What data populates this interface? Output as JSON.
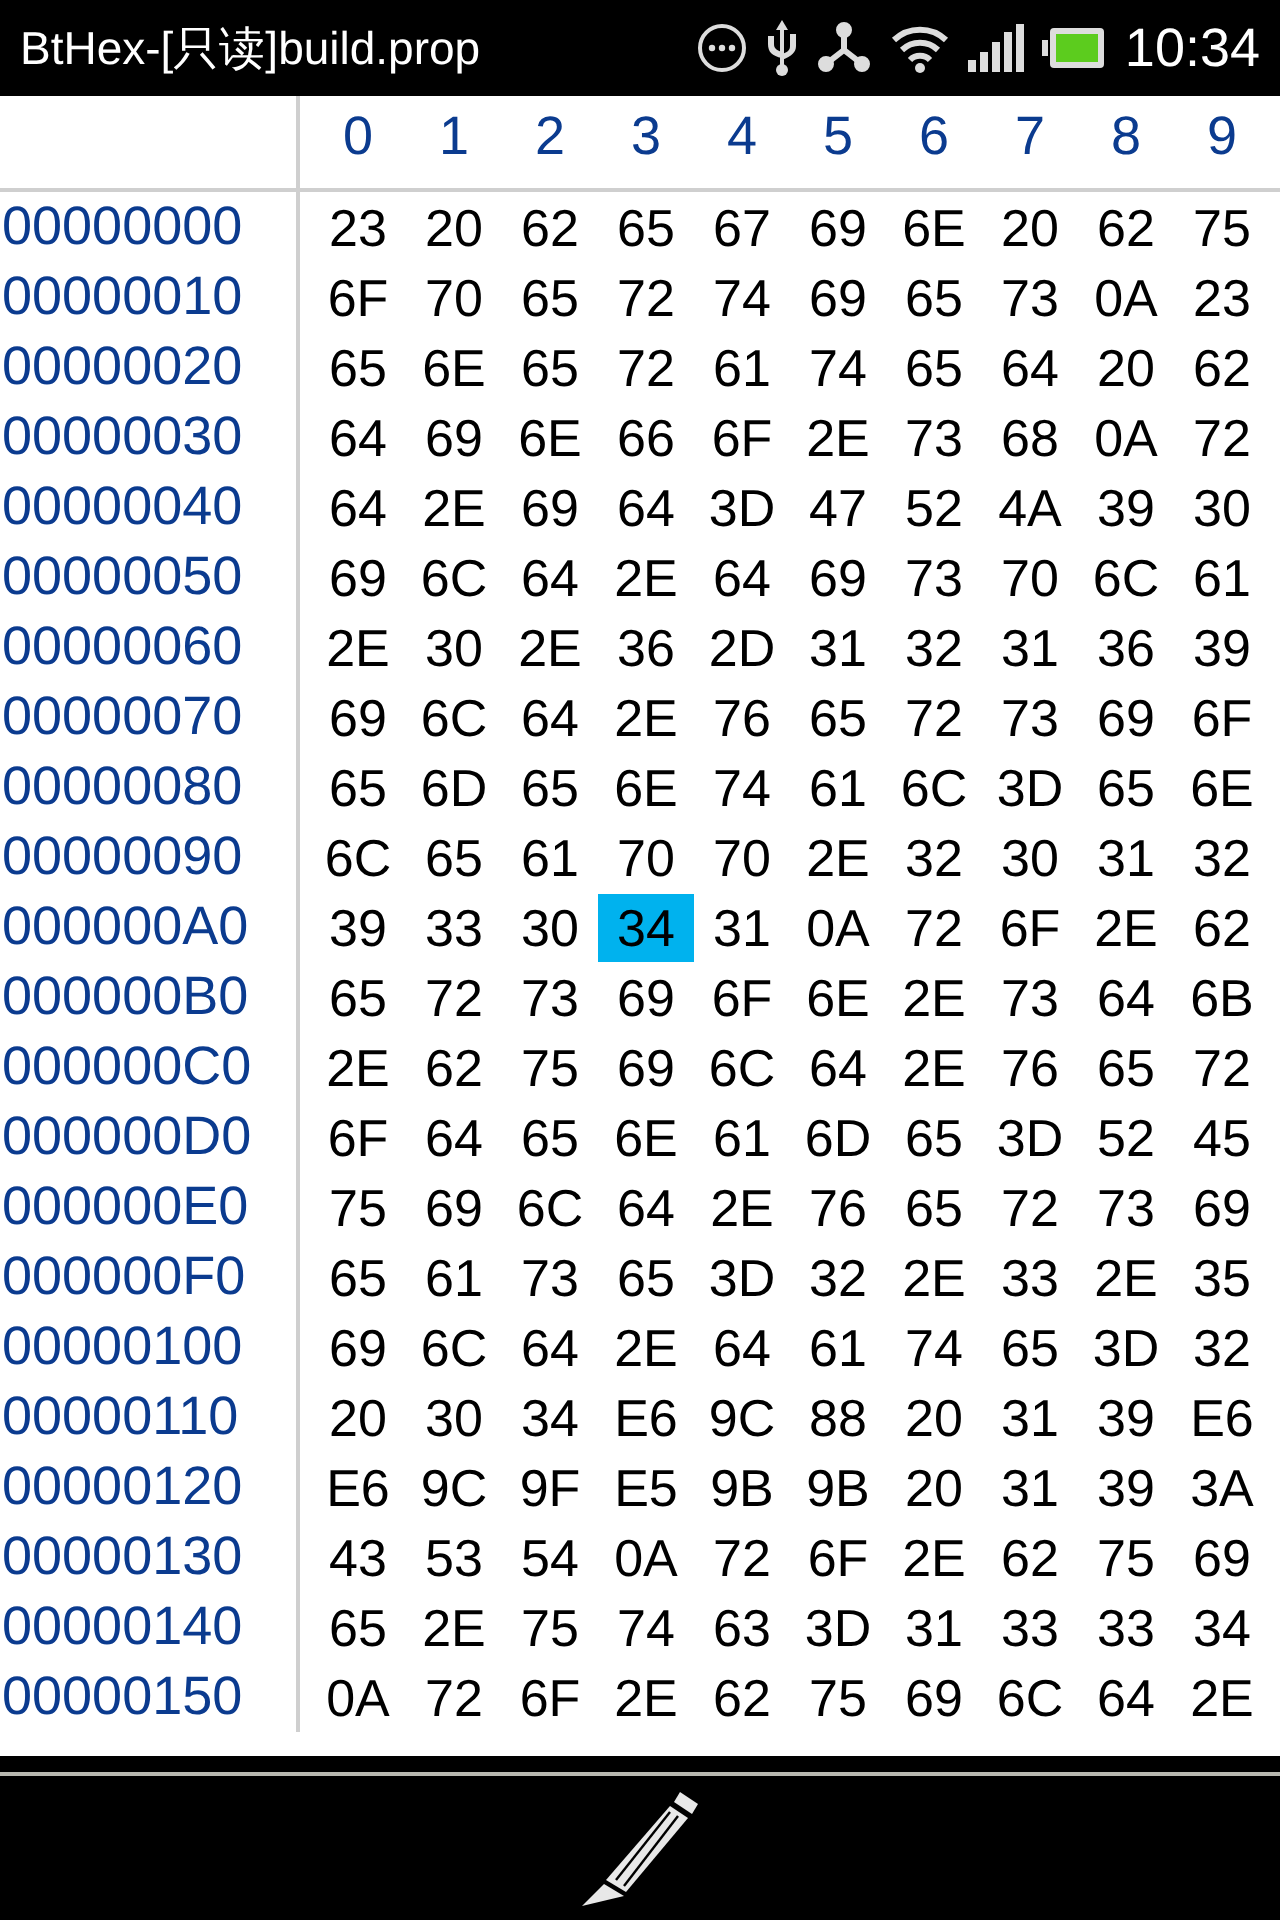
{
  "status_bar": {
    "title": "BtHex-[只读]build.prop",
    "time": "10:34"
  },
  "columns": [
    "0",
    "1",
    "2",
    "3",
    "4",
    "5",
    "6",
    "7",
    "8",
    "9"
  ],
  "rows": [
    {
      "address": "00000000",
      "cells": [
        {
          "text": "23",
          "selected": false
        },
        {
          "text": "20",
          "selected": false
        },
        {
          "text": "62",
          "selected": false
        },
        {
          "text": "65",
          "selected": false
        },
        {
          "text": "67",
          "selected": false
        },
        {
          "text": "69",
          "selected": false
        },
        {
          "text": "6E",
          "selected": false
        },
        {
          "text": "20",
          "selected": false
        },
        {
          "text": "62",
          "selected": false
        },
        {
          "text": "75",
          "selected": false
        }
      ]
    },
    {
      "address": "00000010",
      "cells": [
        {
          "text": "6F",
          "selected": false
        },
        {
          "text": "70",
          "selected": false
        },
        {
          "text": "65",
          "selected": false
        },
        {
          "text": "72",
          "selected": false
        },
        {
          "text": "74",
          "selected": false
        },
        {
          "text": "69",
          "selected": false
        },
        {
          "text": "65",
          "selected": false
        },
        {
          "text": "73",
          "selected": false
        },
        {
          "text": "0A",
          "selected": false
        },
        {
          "text": "23",
          "selected": false
        }
      ]
    },
    {
      "address": "00000020",
      "cells": [
        {
          "text": "65",
          "selected": false
        },
        {
          "text": "6E",
          "selected": false
        },
        {
          "text": "65",
          "selected": false
        },
        {
          "text": "72",
          "selected": false
        },
        {
          "text": "61",
          "selected": false
        },
        {
          "text": "74",
          "selected": false
        },
        {
          "text": "65",
          "selected": false
        },
        {
          "text": "64",
          "selected": false
        },
        {
          "text": "20",
          "selected": false
        },
        {
          "text": "62",
          "selected": false
        }
      ]
    },
    {
      "address": "00000030",
      "cells": [
        {
          "text": "64",
          "selected": false
        },
        {
          "text": "69",
          "selected": false
        },
        {
          "text": "6E",
          "selected": false
        },
        {
          "text": "66",
          "selected": false
        },
        {
          "text": "6F",
          "selected": false
        },
        {
          "text": "2E",
          "selected": false
        },
        {
          "text": "73",
          "selected": false
        },
        {
          "text": "68",
          "selected": false
        },
        {
          "text": "0A",
          "selected": false
        },
        {
          "text": "72",
          "selected": false
        }
      ]
    },
    {
      "address": "00000040",
      "cells": [
        {
          "text": "64",
          "selected": false
        },
        {
          "text": "2E",
          "selected": false
        },
        {
          "text": "69",
          "selected": false
        },
        {
          "text": "64",
          "selected": false
        },
        {
          "text": "3D",
          "selected": false
        },
        {
          "text": "47",
          "selected": false
        },
        {
          "text": "52",
          "selected": false
        },
        {
          "text": "4A",
          "selected": false
        },
        {
          "text": "39",
          "selected": false
        },
        {
          "text": "30",
          "selected": false
        }
      ]
    },
    {
      "address": "00000050",
      "cells": [
        {
          "text": "69",
          "selected": false
        },
        {
          "text": "6C",
          "selected": false
        },
        {
          "text": "64",
          "selected": false
        },
        {
          "text": "2E",
          "selected": false
        },
        {
          "text": "64",
          "selected": false
        },
        {
          "text": "69",
          "selected": false
        },
        {
          "text": "73",
          "selected": false
        },
        {
          "text": "70",
          "selected": false
        },
        {
          "text": "6C",
          "selected": false
        },
        {
          "text": "61",
          "selected": false
        }
      ]
    },
    {
      "address": "00000060",
      "cells": [
        {
          "text": "2E",
          "selected": false
        },
        {
          "text": "30",
          "selected": false
        },
        {
          "text": "2E",
          "selected": false
        },
        {
          "text": "36",
          "selected": false
        },
        {
          "text": "2D",
          "selected": false
        },
        {
          "text": "31",
          "selected": false
        },
        {
          "text": "32",
          "selected": false
        },
        {
          "text": "31",
          "selected": false
        },
        {
          "text": "36",
          "selected": false
        },
        {
          "text": "39",
          "selected": false
        }
      ]
    },
    {
      "address": "00000070",
      "cells": [
        {
          "text": "69",
          "selected": false
        },
        {
          "text": "6C",
          "selected": false
        },
        {
          "text": "64",
          "selected": false
        },
        {
          "text": "2E",
          "selected": false
        },
        {
          "text": "76",
          "selected": false
        },
        {
          "text": "65",
          "selected": false
        },
        {
          "text": "72",
          "selected": false
        },
        {
          "text": "73",
          "selected": false
        },
        {
          "text": "69",
          "selected": false
        },
        {
          "text": "6F",
          "selected": false
        }
      ]
    },
    {
      "address": "00000080",
      "cells": [
        {
          "text": "65",
          "selected": false
        },
        {
          "text": "6D",
          "selected": false
        },
        {
          "text": "65",
          "selected": false
        },
        {
          "text": "6E",
          "selected": false
        },
        {
          "text": "74",
          "selected": false
        },
        {
          "text": "61",
          "selected": false
        },
        {
          "text": "6C",
          "selected": false
        },
        {
          "text": "3D",
          "selected": false
        },
        {
          "text": "65",
          "selected": false
        },
        {
          "text": "6E",
          "selected": false
        }
      ]
    },
    {
      "address": "00000090",
      "cells": [
        {
          "text": "6C",
          "selected": false
        },
        {
          "text": "65",
          "selected": false
        },
        {
          "text": "61",
          "selected": false
        },
        {
          "text": "70",
          "selected": false
        },
        {
          "text": "70",
          "selected": false
        },
        {
          "text": "2E",
          "selected": false
        },
        {
          "text": "32",
          "selected": false
        },
        {
          "text": "30",
          "selected": false
        },
        {
          "text": "31",
          "selected": false
        },
        {
          "text": "32",
          "selected": false
        }
      ]
    },
    {
      "address": "000000A0",
      "cells": [
        {
          "text": "39",
          "selected": false
        },
        {
          "text": "33",
          "selected": false
        },
        {
          "text": "30",
          "selected": false
        },
        {
          "text": "34",
          "selected": true
        },
        {
          "text": "31",
          "selected": false
        },
        {
          "text": "0A",
          "selected": false
        },
        {
          "text": "72",
          "selected": false
        },
        {
          "text": "6F",
          "selected": false
        },
        {
          "text": "2E",
          "selected": false
        },
        {
          "text": "62",
          "selected": false
        }
      ]
    },
    {
      "address": "000000B0",
      "cells": [
        {
          "text": "65",
          "selected": false
        },
        {
          "text": "72",
          "selected": false
        },
        {
          "text": "73",
          "selected": false
        },
        {
          "text": "69",
          "selected": false
        },
        {
          "text": "6F",
          "selected": false
        },
        {
          "text": "6E",
          "selected": false
        },
        {
          "text": "2E",
          "selected": false
        },
        {
          "text": "73",
          "selected": false
        },
        {
          "text": "64",
          "selected": false
        },
        {
          "text": "6B",
          "selected": false
        }
      ]
    },
    {
      "address": "000000C0",
      "cells": [
        {
          "text": "2E",
          "selected": false
        },
        {
          "text": "62",
          "selected": false
        },
        {
          "text": "75",
          "selected": false
        },
        {
          "text": "69",
          "selected": false
        },
        {
          "text": "6C",
          "selected": false
        },
        {
          "text": "64",
          "selected": false
        },
        {
          "text": "2E",
          "selected": false
        },
        {
          "text": "76",
          "selected": false
        },
        {
          "text": "65",
          "selected": false
        },
        {
          "text": "72",
          "selected": false
        }
      ]
    },
    {
      "address": "000000D0",
      "cells": [
        {
          "text": "6F",
          "selected": false
        },
        {
          "text": "64",
          "selected": false
        },
        {
          "text": "65",
          "selected": false
        },
        {
          "text": "6E",
          "selected": false
        },
        {
          "text": "61",
          "selected": false
        },
        {
          "text": "6D",
          "selected": false
        },
        {
          "text": "65",
          "selected": false
        },
        {
          "text": "3D",
          "selected": false
        },
        {
          "text": "52",
          "selected": false
        },
        {
          "text": "45",
          "selected": false
        }
      ]
    },
    {
      "address": "000000E0",
      "cells": [
        {
          "text": "75",
          "selected": false
        },
        {
          "text": "69",
          "selected": false
        },
        {
          "text": "6C",
          "selected": false
        },
        {
          "text": "64",
          "selected": false
        },
        {
          "text": "2E",
          "selected": false
        },
        {
          "text": "76",
          "selected": false
        },
        {
          "text": "65",
          "selected": false
        },
        {
          "text": "72",
          "selected": false
        },
        {
          "text": "73",
          "selected": false
        },
        {
          "text": "69",
          "selected": false
        }
      ]
    },
    {
      "address": "000000F0",
      "cells": [
        {
          "text": "65",
          "selected": false
        },
        {
          "text": "61",
          "selected": false
        },
        {
          "text": "73",
          "selected": false
        },
        {
          "text": "65",
          "selected": false
        },
        {
          "text": "3D",
          "selected": false
        },
        {
          "text": "32",
          "selected": false
        },
        {
          "text": "2E",
          "selected": false
        },
        {
          "text": "33",
          "selected": false
        },
        {
          "text": "2E",
          "selected": false
        },
        {
          "text": "35",
          "selected": false
        }
      ]
    },
    {
      "address": "00000100",
      "cells": [
        {
          "text": "69",
          "selected": false
        },
        {
          "text": "6C",
          "selected": false
        },
        {
          "text": "64",
          "selected": false
        },
        {
          "text": "2E",
          "selected": false
        },
        {
          "text": "64",
          "selected": false
        },
        {
          "text": "61",
          "selected": false
        },
        {
          "text": "74",
          "selected": false
        },
        {
          "text": "65",
          "selected": false
        },
        {
          "text": "3D",
          "selected": false
        },
        {
          "text": "32",
          "selected": false
        }
      ]
    },
    {
      "address": "00000110",
      "cells": [
        {
          "text": "20",
          "selected": false
        },
        {
          "text": "30",
          "selected": false
        },
        {
          "text": "34",
          "selected": false
        },
        {
          "text": "E6",
          "selected": false
        },
        {
          "text": "9C",
          "selected": false
        },
        {
          "text": "88",
          "selected": false
        },
        {
          "text": "20",
          "selected": false
        },
        {
          "text": "31",
          "selected": false
        },
        {
          "text": "39",
          "selected": false
        },
        {
          "text": "E6",
          "selected": false
        }
      ]
    },
    {
      "address": "00000120",
      "cells": [
        {
          "text": "E6",
          "selected": false
        },
        {
          "text": "9C",
          "selected": false
        },
        {
          "text": "9F",
          "selected": false
        },
        {
          "text": "E5",
          "selected": false
        },
        {
          "text": "9B",
          "selected": false
        },
        {
          "text": "9B",
          "selected": false
        },
        {
          "text": "20",
          "selected": false
        },
        {
          "text": "31",
          "selected": false
        },
        {
          "text": "39",
          "selected": false
        },
        {
          "text": "3A",
          "selected": false
        }
      ]
    },
    {
      "address": "00000130",
      "cells": [
        {
          "text": "43",
          "selected": false
        },
        {
          "text": "53",
          "selected": false
        },
        {
          "text": "54",
          "selected": false
        },
        {
          "text": "0A",
          "selected": false
        },
        {
          "text": "72",
          "selected": false
        },
        {
          "text": "6F",
          "selected": false
        },
        {
          "text": "2E",
          "selected": false
        },
        {
          "text": "62",
          "selected": false
        },
        {
          "text": "75",
          "selected": false
        },
        {
          "text": "69",
          "selected": false
        }
      ]
    },
    {
      "address": "00000140",
      "cells": [
        {
          "text": "65",
          "selected": false
        },
        {
          "text": "2E",
          "selected": false
        },
        {
          "text": "75",
          "selected": false
        },
        {
          "text": "74",
          "selected": false
        },
        {
          "text": "63",
          "selected": false
        },
        {
          "text": "3D",
          "selected": false
        },
        {
          "text": "31",
          "selected": false
        },
        {
          "text": "33",
          "selected": false
        },
        {
          "text": "33",
          "selected": false
        },
        {
          "text": "34",
          "selected": false
        }
      ]
    },
    {
      "address": "00000150",
      "cells": [
        {
          "text": "0A",
          "selected": false
        },
        {
          "text": "72",
          "selected": false
        },
        {
          "text": "6F",
          "selected": false
        },
        {
          "text": "2E",
          "selected": false
        },
        {
          "text": "62",
          "selected": false
        },
        {
          "text": "75",
          "selected": false
        },
        {
          "text": "69",
          "selected": false
        },
        {
          "text": "6C",
          "selected": false
        },
        {
          "text": "64",
          "selected": false
        },
        {
          "text": "2E",
          "selected": false
        }
      ]
    }
  ]
}
